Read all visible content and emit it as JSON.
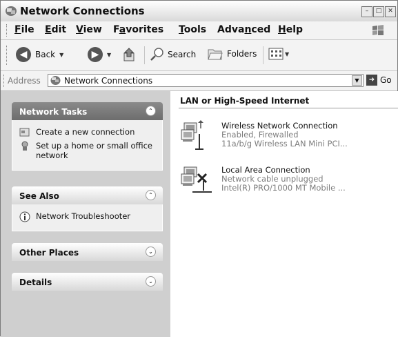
{
  "window": {
    "title": "Network Connections",
    "controls": [
      "min",
      "max",
      "close"
    ]
  },
  "menu": [
    {
      "label": "File",
      "u": "F",
      "rest": "ile"
    },
    {
      "label": "Edit",
      "u": "E",
      "rest": "dit"
    },
    {
      "label": "View",
      "u": "V",
      "rest": "iew"
    },
    {
      "label": "Favorites",
      "pre": "F",
      "u": "a",
      "rest": "vorites"
    },
    {
      "label": "Tools",
      "u": "T",
      "rest": "ools"
    },
    {
      "label": "Advanced",
      "pre": "Adva",
      "u": "n",
      "rest": "ced"
    },
    {
      "label": "Help",
      "u": "H",
      "rest": "elp"
    }
  ],
  "toolbar": {
    "back_label": "Back",
    "search_label": "Search",
    "folders_label": "Folders"
  },
  "address": {
    "label": "Address",
    "value": "Network Connections",
    "go_label": "Go"
  },
  "taskpane": {
    "network_tasks": {
      "title": "Network Tasks",
      "items": [
        "Create a new connection",
        "Set up a home or small office network"
      ]
    },
    "see_also": {
      "title": "See Also",
      "items": [
        "Network Troubleshooter"
      ]
    },
    "other_places": {
      "title": "Other Places"
    },
    "details": {
      "title": "Details"
    }
  },
  "content": {
    "group_title": "LAN or High-Speed Internet",
    "connections": [
      {
        "name": "Wireless Network Connection",
        "status": "Enabled, Firewalled",
        "device": "11a/b/g Wireless LAN Mini PCI..."
      },
      {
        "name": "Local Area Connection",
        "status": "Network cable unplugged",
        "device": "Intel(R) PRO/1000 MT Mobile ..."
      }
    ]
  }
}
